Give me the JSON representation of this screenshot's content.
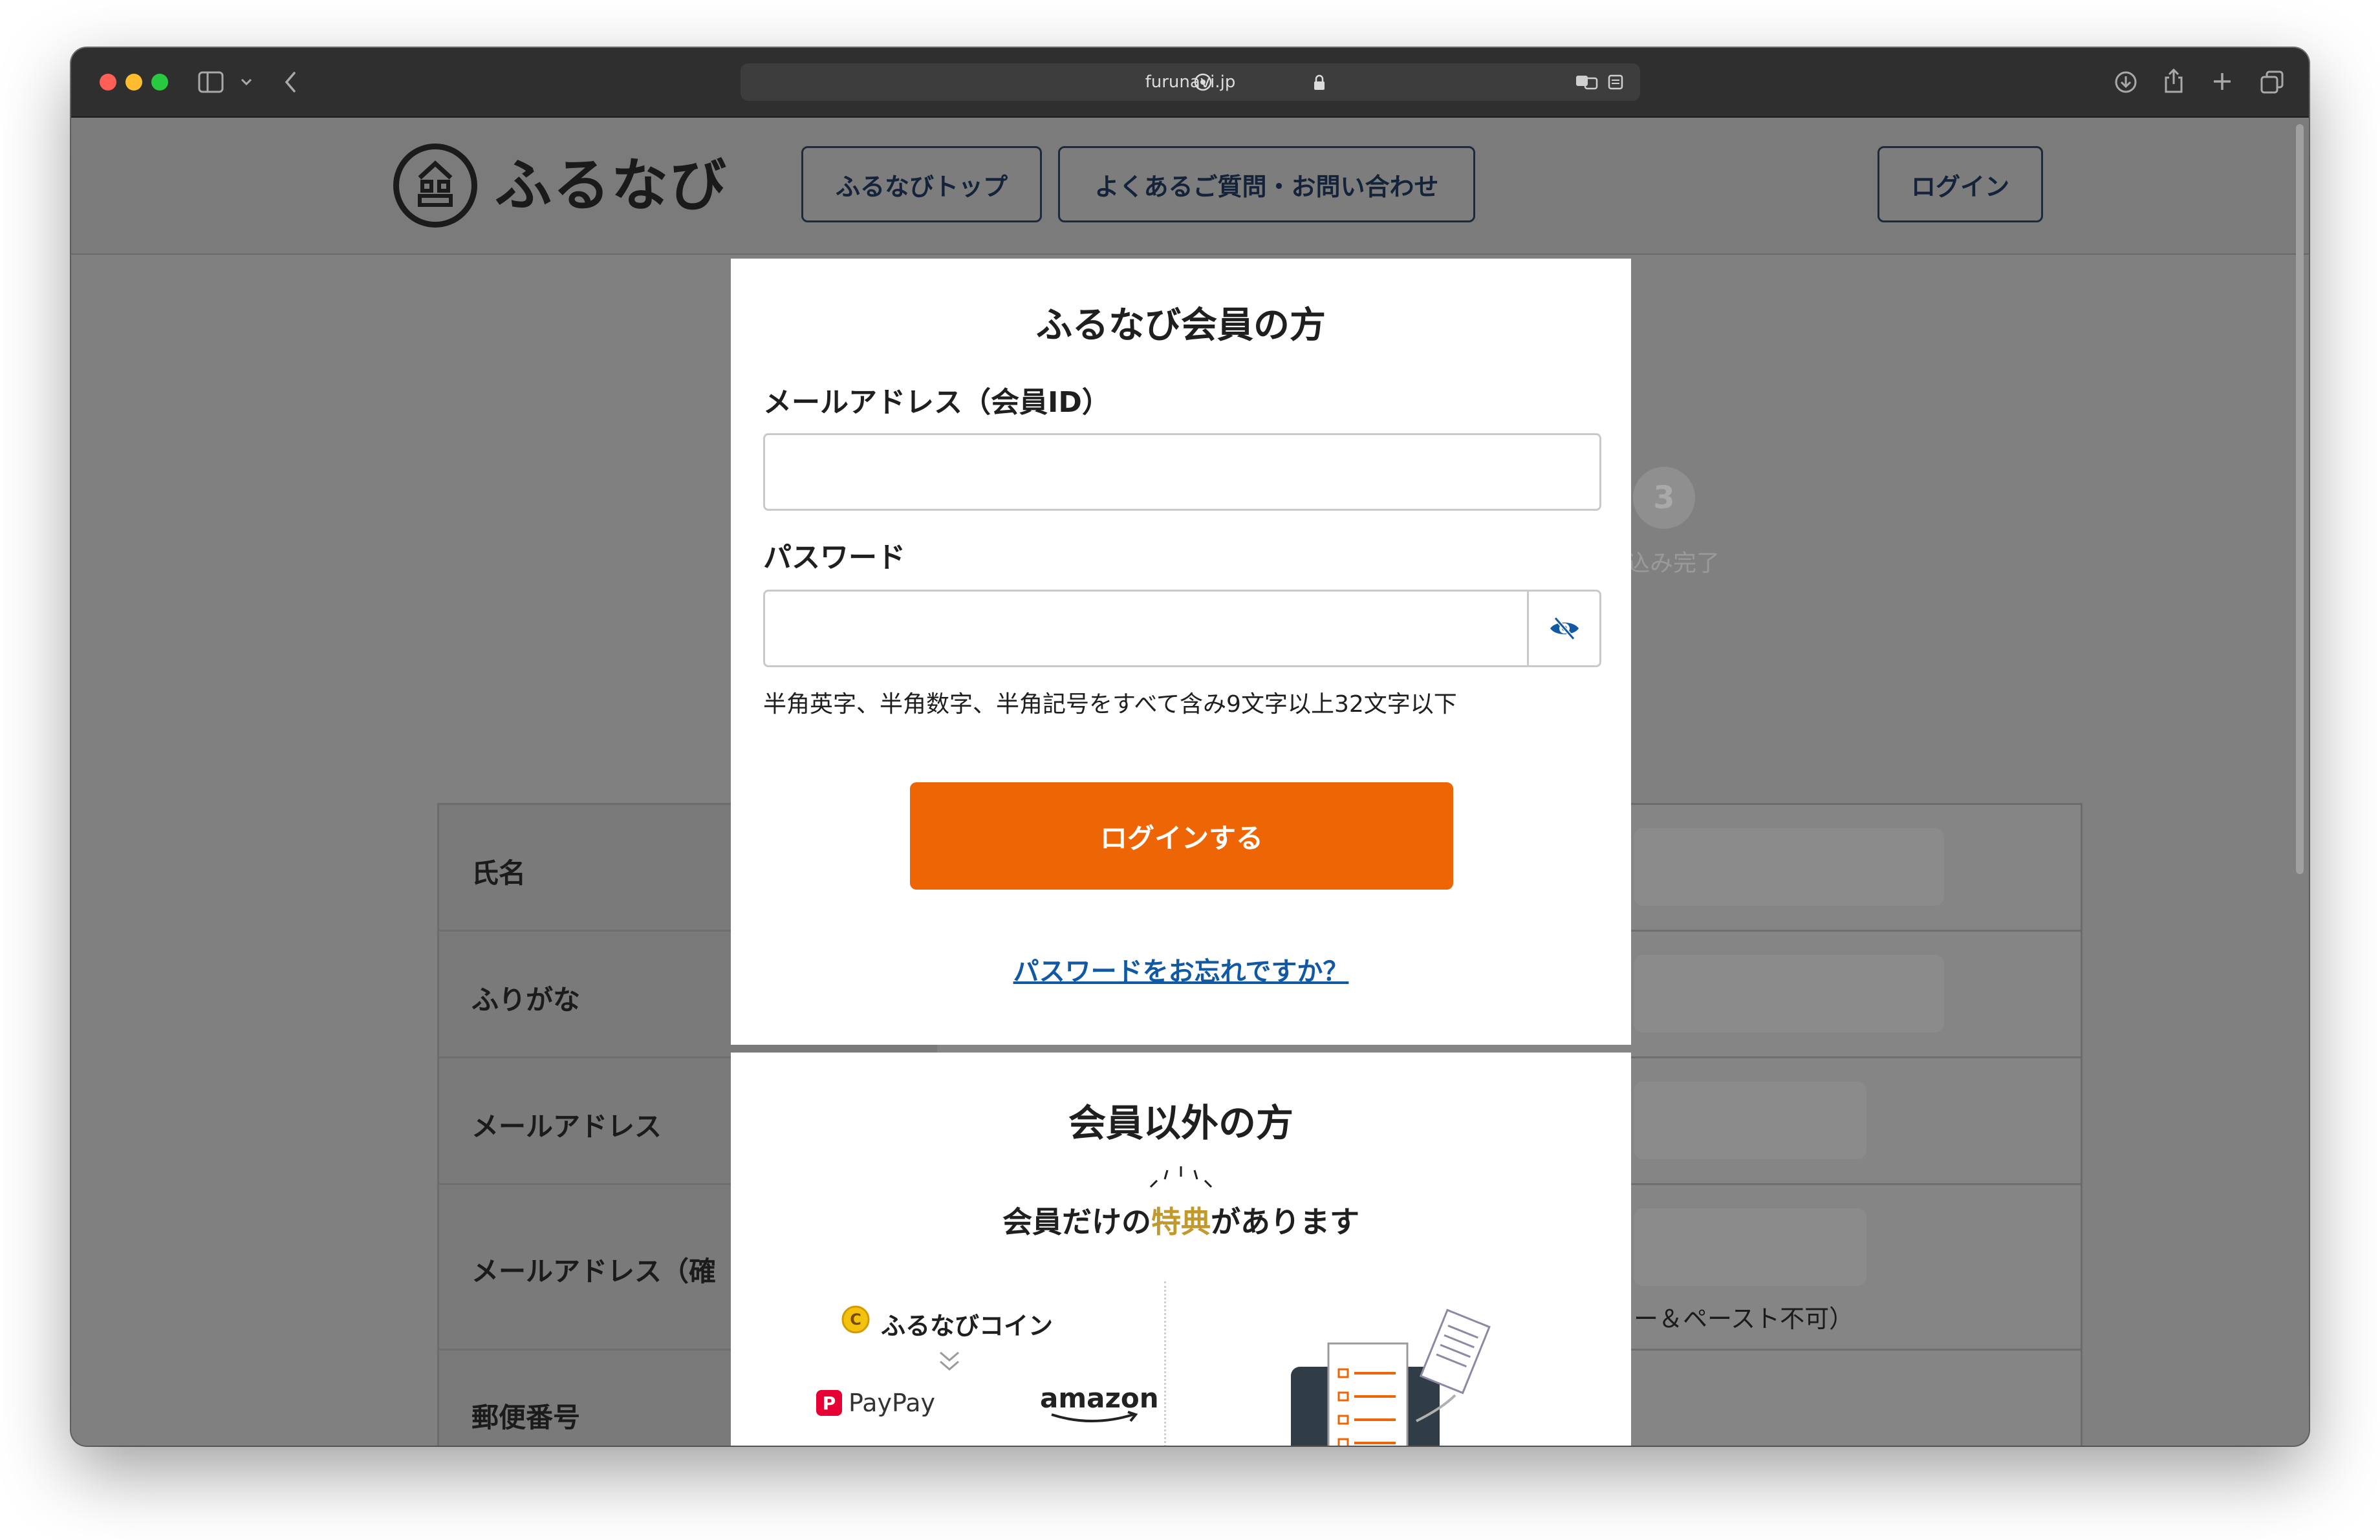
{
  "browser": {
    "url": "furunavi.jp",
    "traffic_lights": {
      "close": "#ff5f57",
      "minimize": "#febc2e",
      "zoom": "#28c840"
    },
    "icons": [
      "sidebar-icon",
      "chevron-down-icon",
      "back-icon",
      "site-settings-icon",
      "lock-icon",
      "translate-icon",
      "reader-icon",
      "download-icon",
      "share-icon",
      "new-tab-icon",
      "tab-overview-icon"
    ]
  },
  "site_header": {
    "logo_text": "ふるなび",
    "nav": [
      "ふるなびトップ",
      "よくあるご質問・お問い合わせ"
    ],
    "login": "ログイン"
  },
  "steps": {
    "step3_number": "3",
    "step3_label": "込み完了"
  },
  "background_form": {
    "rows": [
      "氏名",
      "ふりがな",
      "メールアドレス",
      "メールアドレス（確",
      "郵便番号"
    ],
    "confirm_note": "ー＆ペースト不可）"
  },
  "member_login": {
    "title": "ふるなび会員の方",
    "email_label": "メールアドレス（会員ID）",
    "email_value": "",
    "password_label": "パスワード",
    "password_value": "",
    "password_hint": "半角英字、半角数字、半角記号をすべて含み9文字以上32文字以下",
    "login_button": "ログインする",
    "forgot_link": "パスワードをお忘れですか？",
    "accent_color": "#ee6506",
    "link_color": "#1158a5"
  },
  "non_member": {
    "title": "会員以外の方",
    "benefit_prefix": "会員だけの",
    "benefit_highlight": "特典",
    "benefit_suffix": "があります",
    "coin_label": "ふるなびコイン",
    "partners": [
      "PayPay",
      "amazon"
    ],
    "highlight_color": "#c29a2c"
  }
}
